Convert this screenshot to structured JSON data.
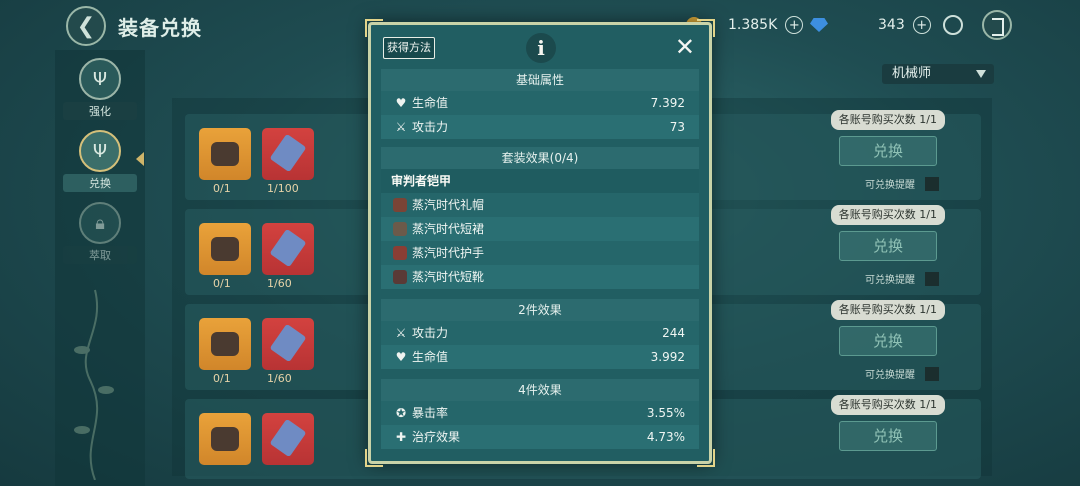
{
  "header": {
    "back_icon": "back-arrow-icon",
    "title": "装备兑换",
    "gold_value": "1.385K",
    "gem_value": "343",
    "plus": "+"
  },
  "sidebar": {
    "items": [
      {
        "label": "强化",
        "icon": "trident-icon",
        "state": "normal"
      },
      {
        "label": "兑换",
        "icon": "trident-icon",
        "state": "active"
      },
      {
        "label": "萃取",
        "icon": "lock-icon",
        "state": "locked"
      }
    ]
  },
  "class_filter": {
    "selected": "机械师"
  },
  "exchange_rows": [
    {
      "owned": "0/1",
      "cost": "1/100",
      "limit": "各账号购买次数 1/1",
      "button": "兑换",
      "remind": "可兑换提醒"
    },
    {
      "owned": "0/1",
      "cost": "1/60",
      "limit": "各账号购买次数 1/1",
      "button": "兑换",
      "remind": "可兑换提醒"
    },
    {
      "owned": "0/1",
      "cost": "1/60",
      "limit": "各账号购买次数 1/1",
      "button": "兑换",
      "remind": "可兑换提醒"
    },
    {
      "owned": "",
      "cost": "",
      "limit": "各账号购买次数 1/1",
      "button": "兑换",
      "remind": ""
    }
  ],
  "modal": {
    "obtain_label": "获得方法",
    "info_symbol": "i",
    "close_symbol": "✕",
    "base_header": "基础属性",
    "base_stats": [
      {
        "icon": "heart-icon",
        "glyph": "♥",
        "label": "生命值",
        "value": "7.392"
      },
      {
        "icon": "crossed-swords-icon",
        "glyph": "⚔",
        "label": "攻击力",
        "value": "73"
      }
    ],
    "set_header": "套装效果(0/4)",
    "set_name": "审判者铠甲",
    "set_pieces": [
      {
        "label": "蒸汽时代礼帽",
        "color": "#7a4436"
      },
      {
        "label": "蒸汽时代短裙",
        "color": "#6b5a4a"
      },
      {
        "label": "蒸汽时代护手",
        "color": "#8a3e34"
      },
      {
        "label": "蒸汽时代短靴",
        "color": "#5a3a36"
      }
    ],
    "two_piece_header": "2件效果",
    "two_piece_stats": [
      {
        "icon": "crossed-swords-icon",
        "glyph": "⚔",
        "label": "攻击力",
        "value": "244"
      },
      {
        "icon": "heart-icon",
        "glyph": "♥",
        "label": "生命值",
        "value": "3.992"
      }
    ],
    "four_piece_header": "4件效果",
    "four_piece_stats": [
      {
        "icon": "crit-icon",
        "glyph": "✪",
        "label": "暴击率",
        "value": "3.55%"
      },
      {
        "icon": "heal-icon",
        "glyph": "✚",
        "label": "治疗效果",
        "value": "4.73%"
      }
    ]
  }
}
